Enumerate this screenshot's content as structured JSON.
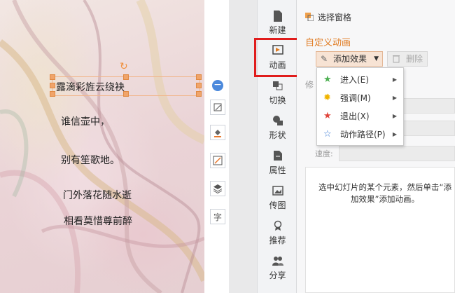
{
  "slide": {
    "poem_lines": [
      "露滴彩旌云绕袂",
      "谁信壶中，",
      "别有笙歌地。",
      "门外落花随水逝",
      "相看莫惜尊前醉"
    ]
  },
  "float_tools": [
    {
      "icon": "crop-icon"
    },
    {
      "icon": "fill-bucket-icon"
    },
    {
      "icon": "line-pen-icon"
    },
    {
      "icon": "layers-icon"
    },
    {
      "icon": "text-format-icon",
      "glyph": "字"
    }
  ],
  "nav": {
    "items": [
      {
        "label": "新建",
        "icon": "new-icon"
      },
      {
        "label": "动画",
        "icon": "animation-icon"
      },
      {
        "label": "切换",
        "icon": "transition-icon"
      },
      {
        "label": "形状",
        "icon": "shape-icon"
      },
      {
        "label": "属性",
        "icon": "properties-icon"
      },
      {
        "label": "传图",
        "icon": "upload-image-icon"
      },
      {
        "label": "推荐",
        "icon": "recommend-icon"
      },
      {
        "label": "分享",
        "icon": "share-icon"
      }
    ]
  },
  "panel": {
    "header": "选择窗格",
    "section_title": "自定义动画",
    "add_effect": "添加效果",
    "delete": "删除",
    "modify_label": "修",
    "speed_label": "速度:",
    "hint": "选中幻灯片的某个元素，然后单击“添加效果”添加动画。"
  },
  "dropdown": {
    "items": [
      {
        "label": "进入(E)",
        "icon": "enter-star-icon",
        "color": "#4caf50"
      },
      {
        "label": "强调(M)",
        "icon": "emphasis-star-icon",
        "color": "#f0b400"
      },
      {
        "label": "退出(X)",
        "icon": "exit-star-icon",
        "color": "#e0443a"
      },
      {
        "label": "动作路径(P)",
        "icon": "motion-path-star-icon",
        "color": "#3a7bd5"
      }
    ]
  },
  "accent_colors": {
    "orange": "#e07a20",
    "highlight_red": "#e01c1c",
    "minus_blue": "#4b89dc"
  }
}
